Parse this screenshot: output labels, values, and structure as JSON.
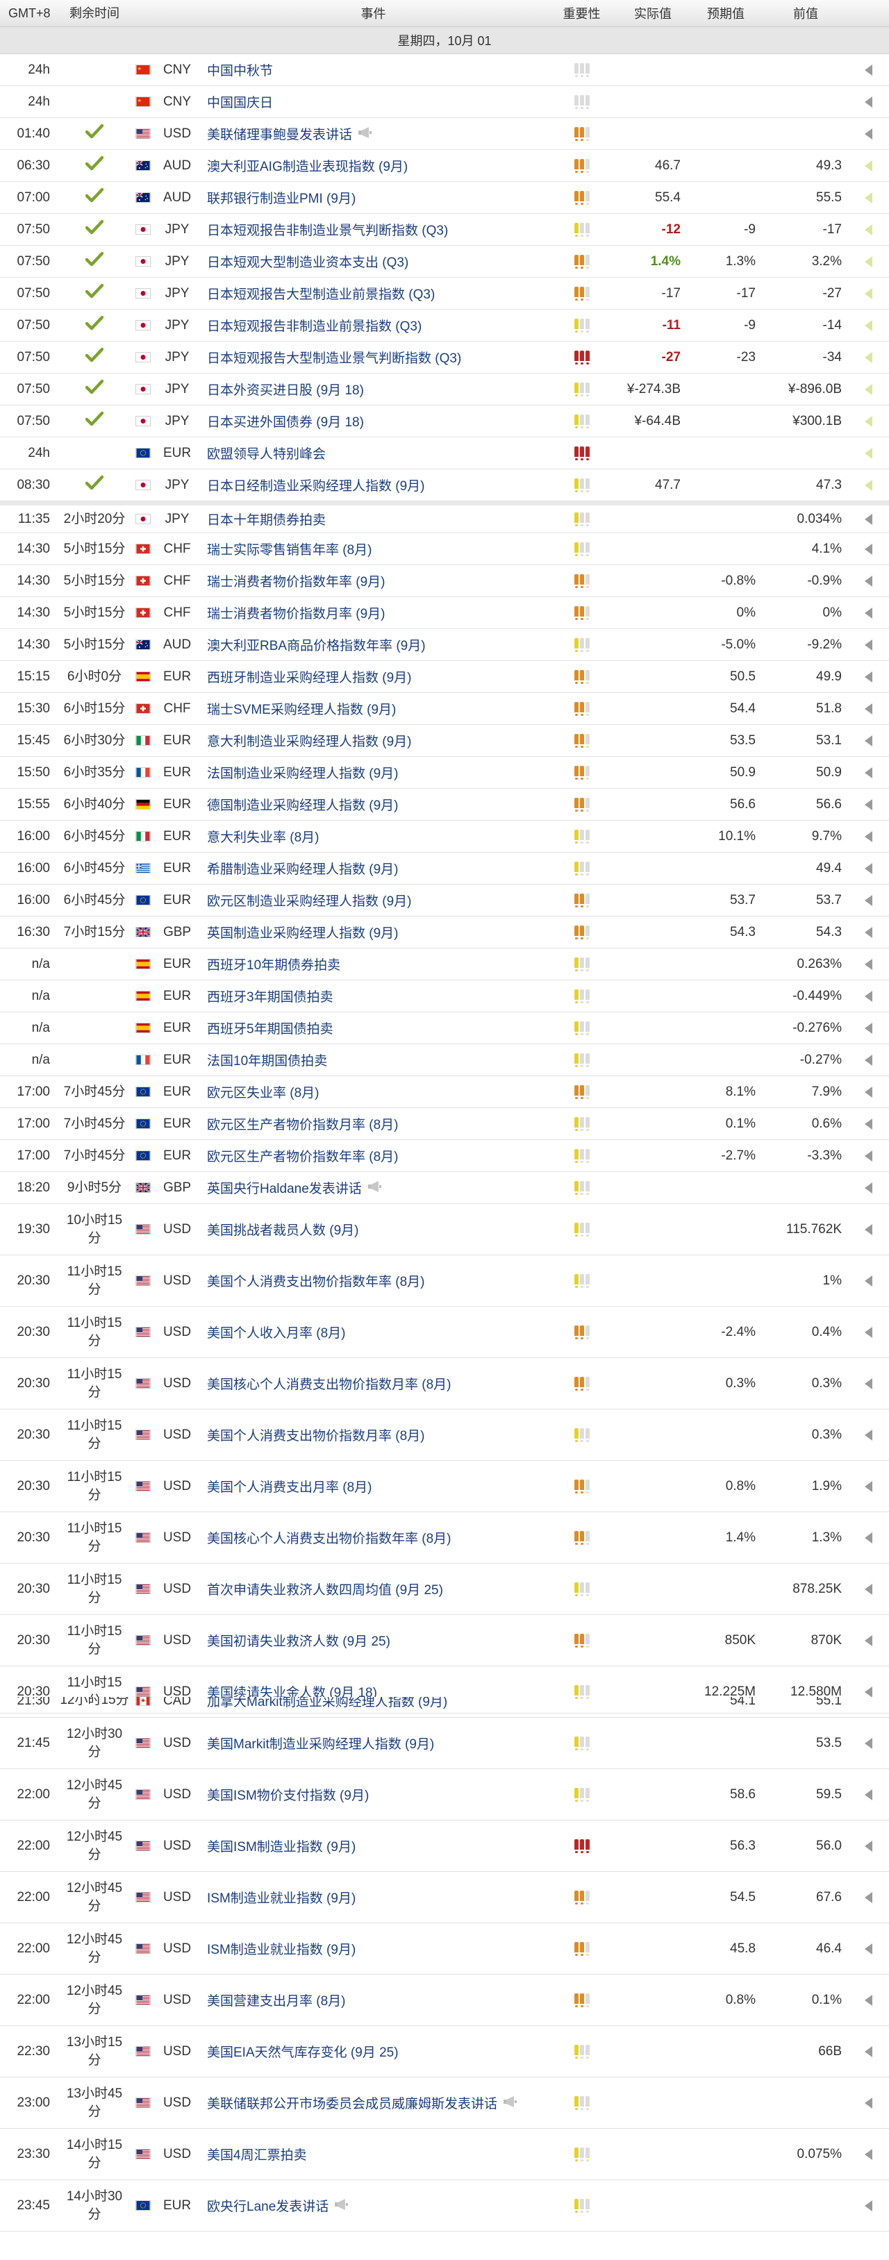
{
  "header": {
    "timezone": "GMT+8",
    "remaining": "剩余时间",
    "event": "事件",
    "importance": "重要性",
    "actual": "实际值",
    "forecast": "预期值",
    "previous": "前值"
  },
  "date_label": "星期四，10月 01",
  "rows": [
    {
      "time": "24h",
      "rem": "",
      "check": false,
      "flag": "cn",
      "cur": "CNY",
      "event": "中国中秋节",
      "speech": false,
      "imp": "off",
      "actual": "",
      "act_class": "",
      "forecast": "",
      "previous": "",
      "mark": "gray",
      "height": 46
    },
    {
      "time": "24h",
      "rem": "",
      "check": false,
      "flag": "cn",
      "cur": "CNY",
      "event": "中国国庆日",
      "speech": false,
      "imp": "off",
      "actual": "",
      "act_class": "",
      "forecast": "",
      "previous": "",
      "mark": "gray",
      "height": 46
    },
    {
      "time": "01:40",
      "rem": "",
      "check": true,
      "flag": "us",
      "cur": "USD",
      "event": "美联储理事鲍曼发表讲话",
      "speech": true,
      "imp": "med",
      "actual": "",
      "act_class": "",
      "forecast": "",
      "previous": "",
      "mark": "gray",
      "height": 46
    },
    {
      "time": "06:30",
      "rem": "",
      "check": true,
      "flag": "au",
      "cur": "AUD",
      "event": "澳大利亚AIG制造业表现指数 (9月)",
      "speech": false,
      "imp": "med",
      "actual": "46.7",
      "act_class": "",
      "forecast": "",
      "previous": "49.3",
      "mark": "green",
      "height": 46
    },
    {
      "time": "07:00",
      "rem": "",
      "check": true,
      "flag": "au",
      "cur": "AUD",
      "event": "联邦银行制造业PMI (9月)",
      "speech": false,
      "imp": "med",
      "actual": "55.4",
      "act_class": "",
      "forecast": "",
      "previous": "55.5",
      "mark": "green",
      "height": 46
    },
    {
      "time": "07:50",
      "rem": "",
      "check": true,
      "flag": "jp",
      "cur": "JPY",
      "event": "日本短观报告非制造业景气判断指数 (Q3)",
      "speech": false,
      "imp": "low",
      "actual": "-12",
      "act_class": "val-red",
      "forecast": "-9",
      "previous": "-17",
      "mark": "green",
      "height": 46
    },
    {
      "time": "07:50",
      "rem": "",
      "check": true,
      "flag": "jp",
      "cur": "JPY",
      "event": "日本短观大型制造业资本支出 (Q3)",
      "speech": false,
      "imp": "med",
      "actual": "1.4%",
      "act_class": "val-green",
      "forecast": "1.3%",
      "previous": "3.2%",
      "mark": "green",
      "height": 46
    },
    {
      "time": "07:50",
      "rem": "",
      "check": true,
      "flag": "jp",
      "cur": "JPY",
      "event": "日本短观报告大型制造业前景指数 (Q3)",
      "speech": false,
      "imp": "med",
      "actual": "-17",
      "act_class": "",
      "forecast": "-17",
      "previous": "-27",
      "mark": "green",
      "height": 46
    },
    {
      "time": "07:50",
      "rem": "",
      "check": true,
      "flag": "jp",
      "cur": "JPY",
      "event": "日本短观报告非制造业前景指数 (Q3)",
      "speech": false,
      "imp": "low",
      "actual": "-11",
      "act_class": "val-red",
      "forecast": "-9",
      "previous": "-14",
      "mark": "green",
      "height": 46
    },
    {
      "time": "07:50",
      "rem": "",
      "check": true,
      "flag": "jp",
      "cur": "JPY",
      "event": "日本短观报告大型制造业景气判断指数 (Q3)",
      "speech": false,
      "imp": "high",
      "actual": "-27",
      "act_class": "val-red",
      "forecast": "-23",
      "previous": "-34",
      "mark": "green",
      "height": 46
    },
    {
      "time": "07:50",
      "rem": "",
      "check": true,
      "flag": "jp",
      "cur": "JPY",
      "event": "日本外资买进日股 (9月 18)",
      "speech": false,
      "imp": "low",
      "actual": "¥-274.3B",
      "act_class": "",
      "forecast": "",
      "previous": "¥-896.0B",
      "mark": "green",
      "height": 46
    },
    {
      "time": "07:50",
      "rem": "",
      "check": true,
      "flag": "jp",
      "cur": "JPY",
      "event": "日本买进外国债券 (9月 18)",
      "speech": false,
      "imp": "low",
      "actual": "¥-64.4B",
      "act_class": "",
      "forecast": "",
      "previous": "¥300.1B",
      "mark": "green",
      "height": 46
    },
    {
      "time": "24h",
      "rem": "",
      "check": false,
      "flag": "eu",
      "cur": "EUR",
      "event": "欧盟领导人特别峰会",
      "speech": false,
      "imp": "high",
      "actual": "",
      "act_class": "",
      "forecast": "",
      "previous": "",
      "mark": "green",
      "height": 46
    },
    {
      "time": "08:30",
      "rem": "",
      "check": true,
      "flag": "jp",
      "cur": "JPY",
      "event": "日本日经制造业采购经理人指数 (9月)",
      "speech": false,
      "imp": "low",
      "actual": "47.7",
      "act_class": "",
      "forecast": "",
      "previous": "47.3",
      "mark": "green",
      "height": 46
    },
    {
      "time": "11:35",
      "rem": "2小时20分",
      "check": false,
      "flag": "jp",
      "cur": "JPY",
      "event": "日本十年期债券拍卖",
      "speech": false,
      "imp": "low",
      "actual": "",
      "act_class": "",
      "forecast": "",
      "previous": "0.034%",
      "mark": "gray",
      "height": 46,
      "sep": true
    },
    {
      "time": "14:30",
      "rem": "5小时15分",
      "check": false,
      "flag": "ch",
      "cur": "CHF",
      "event": "瑞士实际零售销售年率 (8月)",
      "speech": false,
      "imp": "low",
      "actual": "",
      "act_class": "",
      "forecast": "",
      "previous": "4.1%",
      "mark": "gray",
      "height": 46
    },
    {
      "time": "14:30",
      "rem": "5小时15分",
      "check": false,
      "flag": "ch",
      "cur": "CHF",
      "event": "瑞士消费者物价指数年率 (9月)",
      "speech": false,
      "imp": "med",
      "actual": "",
      "act_class": "",
      "forecast": "-0.8%",
      "previous": "-0.9%",
      "mark": "gray",
      "height": 46
    },
    {
      "time": "14:30",
      "rem": "5小时15分",
      "check": false,
      "flag": "ch",
      "cur": "CHF",
      "event": "瑞士消费者物价指数月率 (9月)",
      "speech": false,
      "imp": "med",
      "actual": "",
      "act_class": "",
      "forecast": "0%",
      "previous": "0%",
      "mark": "gray",
      "height": 46
    },
    {
      "time": "14:30",
      "rem": "5小时15分",
      "check": false,
      "flag": "au",
      "cur": "AUD",
      "event": "澳大利亚RBA商品价格指数年率 (9月)",
      "speech": false,
      "imp": "low",
      "actual": "",
      "act_class": "",
      "forecast": "-5.0%",
      "previous": "-9.2%",
      "mark": "gray",
      "height": 46
    },
    {
      "time": "15:15",
      "rem": "6小时0分",
      "check": false,
      "flag": "es",
      "cur": "EUR",
      "event": "西班牙制造业采购经理人指数 (9月)",
      "speech": false,
      "imp": "med",
      "actual": "",
      "act_class": "",
      "forecast": "50.5",
      "previous": "49.9",
      "mark": "gray",
      "height": 46
    },
    {
      "time": "15:30",
      "rem": "6小时15分",
      "check": false,
      "flag": "ch",
      "cur": "CHF",
      "event": "瑞士SVME采购经理人指数 (9月)",
      "speech": false,
      "imp": "med",
      "actual": "",
      "act_class": "",
      "forecast": "54.4",
      "previous": "51.8",
      "mark": "gray",
      "height": 46
    },
    {
      "time": "15:45",
      "rem": "6小时30分",
      "check": false,
      "flag": "it",
      "cur": "EUR",
      "event": "意大利制造业采购经理人指数 (9月)",
      "speech": false,
      "imp": "med",
      "actual": "",
      "act_class": "",
      "forecast": "53.5",
      "previous": "53.1",
      "mark": "gray",
      "height": 46
    },
    {
      "time": "15:50",
      "rem": "6小时35分",
      "check": false,
      "flag": "fr",
      "cur": "EUR",
      "event": "法国制造业采购经理人指数 (9月)",
      "speech": false,
      "imp": "med",
      "actual": "",
      "act_class": "",
      "forecast": "50.9",
      "previous": "50.9",
      "mark": "gray",
      "height": 46
    },
    {
      "time": "15:55",
      "rem": "6小时40分",
      "check": false,
      "flag": "de",
      "cur": "EUR",
      "event": "德国制造业采购经理人指数 (9月)",
      "speech": false,
      "imp": "med",
      "actual": "",
      "act_class": "",
      "forecast": "56.6",
      "previous": "56.6",
      "mark": "gray",
      "height": 46
    },
    {
      "time": "16:00",
      "rem": "6小时45分",
      "check": false,
      "flag": "it",
      "cur": "EUR",
      "event": "意大利失业率 (8月)",
      "speech": false,
      "imp": "low",
      "actual": "",
      "act_class": "",
      "forecast": "10.1%",
      "previous": "9.7%",
      "mark": "gray",
      "height": 46
    },
    {
      "time": "16:00",
      "rem": "6小时45分",
      "check": false,
      "flag": "gr",
      "cur": "EUR",
      "event": "希腊制造业采购经理人指数 (9月)",
      "speech": false,
      "imp": "low",
      "actual": "",
      "act_class": "",
      "forecast": "",
      "previous": "49.4",
      "mark": "gray",
      "height": 46
    },
    {
      "time": "16:00",
      "rem": "6小时45分",
      "check": false,
      "flag": "eu",
      "cur": "EUR",
      "event": "欧元区制造业采购经理人指数 (9月)",
      "speech": false,
      "imp": "med",
      "actual": "",
      "act_class": "",
      "forecast": "53.7",
      "previous": "53.7",
      "mark": "gray",
      "height": 46
    },
    {
      "time": "16:30",
      "rem": "7小时15分",
      "check": false,
      "flag": "gb",
      "cur": "GBP",
      "event": "英国制造业采购经理人指数 (9月)",
      "speech": false,
      "imp": "med",
      "actual": "",
      "act_class": "",
      "forecast": "54.3",
      "previous": "54.3",
      "mark": "gray",
      "height": 46
    },
    {
      "time": "n/a",
      "rem": "",
      "check": false,
      "flag": "es",
      "cur": "EUR",
      "event": "西班牙10年期债券拍卖",
      "speech": false,
      "imp": "low",
      "actual": "",
      "act_class": "",
      "forecast": "",
      "previous": "0.263%",
      "mark": "gray",
      "height": 46
    },
    {
      "time": "n/a",
      "rem": "",
      "check": false,
      "flag": "es",
      "cur": "EUR",
      "event": "西班牙3年期国债拍卖",
      "speech": false,
      "imp": "low",
      "actual": "",
      "act_class": "",
      "forecast": "",
      "previous": "-0.449%",
      "mark": "gray",
      "height": 46
    },
    {
      "time": "n/a",
      "rem": "",
      "check": false,
      "flag": "es",
      "cur": "EUR",
      "event": "西班牙5年期国债拍卖",
      "speech": false,
      "imp": "low",
      "actual": "",
      "act_class": "",
      "forecast": "",
      "previous": "-0.276%",
      "mark": "gray",
      "height": 46
    },
    {
      "time": "n/a",
      "rem": "",
      "check": false,
      "flag": "fr",
      "cur": "EUR",
      "event": "法国10年期国债拍卖",
      "speech": false,
      "imp": "low",
      "actual": "",
      "act_class": "",
      "forecast": "",
      "previous": "-0.27%",
      "mark": "gray",
      "height": 46
    },
    {
      "time": "17:00",
      "rem": "7小时45分",
      "check": false,
      "flag": "eu",
      "cur": "EUR",
      "event": "欧元区失业率 (8月)",
      "speech": false,
      "imp": "med",
      "actual": "",
      "act_class": "",
      "forecast": "8.1%",
      "previous": "7.9%",
      "mark": "gray",
      "height": 46
    },
    {
      "time": "17:00",
      "rem": "7小时45分",
      "check": false,
      "flag": "eu",
      "cur": "EUR",
      "event": "欧元区生产者物价指数月率 (8月)",
      "speech": false,
      "imp": "low",
      "actual": "",
      "act_class": "",
      "forecast": "0.1%",
      "previous": "0.6%",
      "mark": "gray",
      "height": 46
    },
    {
      "time": "17:00",
      "rem": "7小时45分",
      "check": false,
      "flag": "eu",
      "cur": "EUR",
      "event": "欧元区生产者物价指数年率 (8月)",
      "speech": false,
      "imp": "low",
      "actual": "",
      "act_class": "",
      "forecast": "-2.7%",
      "previous": "-3.3%",
      "mark": "gray",
      "height": 46
    },
    {
      "time": "18:20",
      "rem": "9小时5分",
      "check": false,
      "flag": "gb",
      "cur": "GBP",
      "event": "英国央行Haldane发表讲话",
      "speech": true,
      "imp": "low",
      "actual": "",
      "act_class": "",
      "forecast": "",
      "previous": "",
      "mark": "gray",
      "height": 46
    },
    {
      "time": "19:30",
      "rem": "10小时15分",
      "check": false,
      "flag": "us",
      "cur": "USD",
      "event": "美国挑战者裁员人数 (9月)",
      "speech": false,
      "imp": "low",
      "actual": "",
      "act_class": "",
      "forecast": "",
      "previous": "115.762K",
      "mark": "gray",
      "height": 74
    },
    {
      "time": "20:30",
      "rem": "11小时15分",
      "check": false,
      "flag": "us",
      "cur": "USD",
      "event": "美国个人消费支出物价指数年率 (8月)",
      "speech": false,
      "imp": "low",
      "actual": "",
      "act_class": "",
      "forecast": "",
      "previous": "1%",
      "mark": "gray",
      "height": 74
    },
    {
      "time": "20:30",
      "rem": "11小时15分",
      "check": false,
      "flag": "us",
      "cur": "USD",
      "event": "美国个人收入月率 (8月)",
      "speech": false,
      "imp": "med",
      "actual": "",
      "act_class": "",
      "forecast": "-2.4%",
      "previous": "0.4%",
      "mark": "gray",
      "height": 74
    },
    {
      "time": "20:30",
      "rem": "11小时15分",
      "check": false,
      "flag": "us",
      "cur": "USD",
      "event": "美国核心个人消费支出物价指数月率 (8月)",
      "speech": false,
      "imp": "med",
      "actual": "",
      "act_class": "",
      "forecast": "0.3%",
      "previous": "0.3%",
      "mark": "gray",
      "height": 74
    },
    {
      "time": "20:30",
      "rem": "11小时15分",
      "check": false,
      "flag": "us",
      "cur": "USD",
      "event": "美国个人消费支出物价指数月率 (8月)",
      "speech": false,
      "imp": "low",
      "actual": "",
      "act_class": "",
      "forecast": "",
      "previous": "0.3%",
      "mark": "gray",
      "height": 74
    },
    {
      "time": "20:30",
      "rem": "11小时15分",
      "check": false,
      "flag": "us",
      "cur": "USD",
      "event": "美国个人消费支出月率 (8月)",
      "speech": false,
      "imp": "med",
      "actual": "",
      "act_class": "",
      "forecast": "0.8%",
      "previous": "1.9%",
      "mark": "gray",
      "height": 74
    },
    {
      "time": "20:30",
      "rem": "11小时15分",
      "check": false,
      "flag": "us",
      "cur": "USD",
      "event": "美国核心个人消费支出物价指数年率 (8月)",
      "speech": false,
      "imp": "med",
      "actual": "",
      "act_class": "",
      "forecast": "1.4%",
      "previous": "1.3%",
      "mark": "gray",
      "height": 74
    },
    {
      "time": "20:30",
      "rem": "11小时15分",
      "check": false,
      "flag": "us",
      "cur": "USD",
      "event": "首次申请失业救济人数四周均值 (9月 25)",
      "speech": false,
      "imp": "low",
      "actual": "",
      "act_class": "",
      "forecast": "",
      "previous": "878.25K",
      "mark": "gray",
      "height": 74
    },
    {
      "time": "20:30",
      "rem": "11小时15分",
      "check": false,
      "flag": "us",
      "cur": "USD",
      "event": "美国初请失业救济人数 (9月 25)",
      "speech": false,
      "imp": "med",
      "actual": "",
      "act_class": "",
      "forecast": "850K",
      "previous": "870K",
      "mark": "gray",
      "height": 74
    },
    {
      "time": "20:30",
      "rem": "11小时15分",
      "check": false,
      "flag": "us",
      "cur": "USD",
      "event": "美国续请失业金人数 (9月 18)",
      "speech": false,
      "imp": "low",
      "actual": "",
      "act_class": "",
      "forecast": "12.225M",
      "previous": "12.580M",
      "mark": "gray",
      "height": 74
    },
    {
      "time": "21:45",
      "rem": "12小时30分",
      "check": false,
      "flag": "us",
      "cur": "USD",
      "event": "美国Markit制造业采购经理人指数 (9月)",
      "speech": false,
      "imp": "low",
      "actual": "",
      "act_class": "",
      "forecast": "",
      "previous": "53.5",
      "mark": "gray",
      "height": 74
    },
    {
      "time": "22:00",
      "rem": "12小时45分",
      "check": false,
      "flag": "us",
      "cur": "USD",
      "event": "美国ISM物价支付指数 (9月)",
      "speech": false,
      "imp": "low",
      "actual": "",
      "act_class": "",
      "forecast": "58.6",
      "previous": "59.5",
      "mark": "gray",
      "height": 74
    },
    {
      "time": "22:00",
      "rem": "12小时45分",
      "check": false,
      "flag": "us",
      "cur": "USD",
      "event": "美国ISM制造业指数 (9月)",
      "speech": false,
      "imp": "high",
      "actual": "",
      "act_class": "",
      "forecast": "56.3",
      "previous": "56.0",
      "mark": "gray",
      "height": 74
    },
    {
      "time": "22:00",
      "rem": "12小时45分",
      "check": false,
      "flag": "us",
      "cur": "USD",
      "event": "ISM制造业就业指数 (9月)",
      "speech": false,
      "imp": "med",
      "actual": "",
      "act_class": "",
      "forecast": "54.5",
      "previous": "67.6",
      "mark": "gray",
      "height": 74
    },
    {
      "time": "22:00",
      "rem": "12小时45分",
      "check": false,
      "flag": "us",
      "cur": "USD",
      "event": "ISM制造业就业指数 (9月)",
      "speech": false,
      "imp": "med",
      "actual": "",
      "act_class": "",
      "forecast": "45.8",
      "previous": "46.4",
      "mark": "gray",
      "height": 74
    },
    {
      "time": "22:00",
      "rem": "12小时45分",
      "check": false,
      "flag": "us",
      "cur": "USD",
      "event": "美国营建支出月率 (8月)",
      "speech": false,
      "imp": "med",
      "actual": "",
      "act_class": "",
      "forecast": "0.8%",
      "previous": "0.1%",
      "mark": "gray",
      "height": 74
    },
    {
      "time": "22:30",
      "rem": "13小时15分",
      "check": false,
      "flag": "us",
      "cur": "USD",
      "event": "美国EIA天然气库存变化 (9月 25)",
      "speech": false,
      "imp": "low",
      "actual": "",
      "act_class": "",
      "forecast": "",
      "previous": "66B",
      "mark": "gray",
      "height": 74
    },
    {
      "time": "23:00",
      "rem": "13小时45分",
      "check": false,
      "flag": "us",
      "cur": "USD",
      "event": "美联储联邦公开市场委员会成员威廉姆斯发表讲话",
      "speech": true,
      "imp": "low",
      "actual": "",
      "act_class": "",
      "forecast": "",
      "previous": "",
      "mark": "gray",
      "height": 74
    },
    {
      "time": "23:30",
      "rem": "14小时15分",
      "check": false,
      "flag": "us",
      "cur": "USD",
      "event": "美国4周汇票拍卖",
      "speech": false,
      "imp": "low",
      "actual": "",
      "act_class": "",
      "forecast": "",
      "previous": "0.075%",
      "mark": "gray",
      "height": 74
    },
    {
      "time": "23:45",
      "rem": "14小时30分",
      "check": false,
      "flag": "eu",
      "cur": "EUR",
      "event": "欧央行Lane发表讲话",
      "speech": true,
      "imp": "low",
      "actual": "",
      "act_class": "",
      "forecast": "",
      "previous": "",
      "mark": "gray",
      "height": 74
    }
  ],
  "overlay_row": {
    "time": "21:30",
    "rem": "12小时15分",
    "flag": "ca",
    "cur": "CAD",
    "event": "加拿大Markit制造业采购经理人指数 (9月)",
    "forecast": "54.1",
    "previous": "55.1"
  }
}
